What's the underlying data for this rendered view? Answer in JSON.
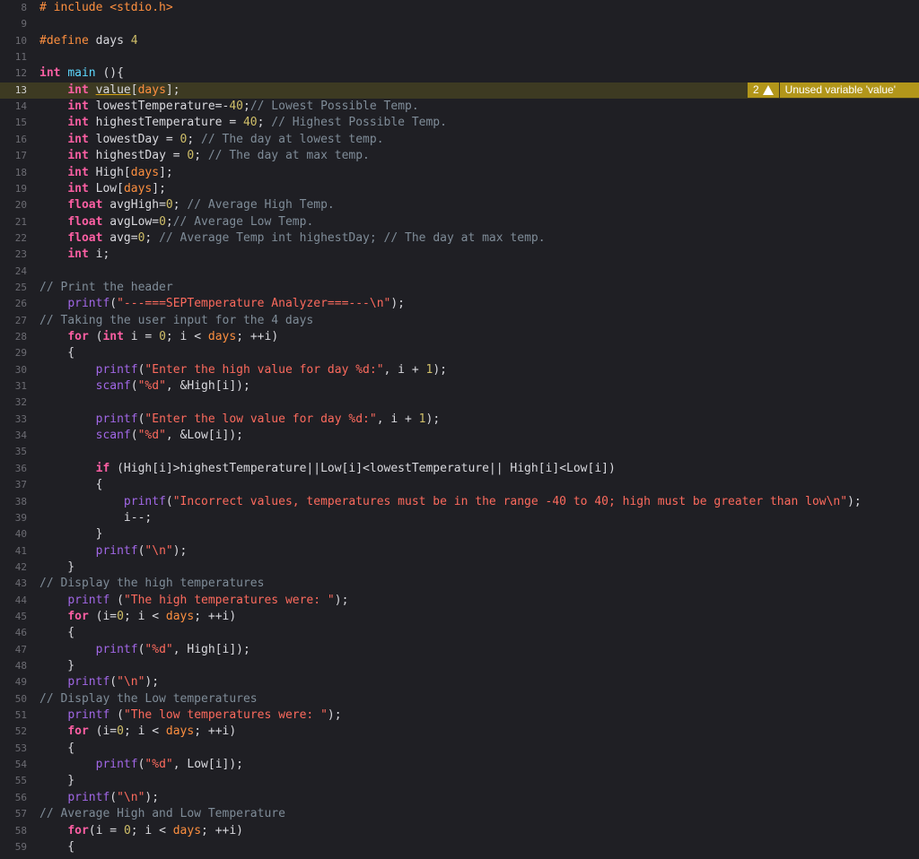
{
  "editor": {
    "lines": [
      {
        "n": "8",
        "code": "# include <stdio.h>"
      },
      {
        "n": "9",
        "code": ""
      },
      {
        "n": "10",
        "code": "#define days 4"
      },
      {
        "n": "11",
        "code": ""
      },
      {
        "n": "12",
        "code": "int main (){"
      },
      {
        "n": "13",
        "code": "    int value[days];"
      },
      {
        "n": "14",
        "code": "    int lowestTemperature=-40;// Lowest Possible Temp."
      },
      {
        "n": "15",
        "code": "    int highestTemperature = 40; // Highest Possible Temp."
      },
      {
        "n": "16",
        "code": "    int lowestDay = 0; // The day at lowest temp."
      },
      {
        "n": "17",
        "code": "    int highestDay = 0; // The day at max temp."
      },
      {
        "n": "18",
        "code": "    int High[days];"
      },
      {
        "n": "19",
        "code": "    int Low[days];"
      },
      {
        "n": "20",
        "code": "    float avgHigh=0; // Average High Temp."
      },
      {
        "n": "21",
        "code": "    float avgLow=0;// Average Low Temp."
      },
      {
        "n": "22",
        "code": "    float avg=0; // Average Temp int highestDay; // The day at max temp."
      },
      {
        "n": "23",
        "code": "    int i;"
      },
      {
        "n": "24",
        "code": ""
      },
      {
        "n": "25",
        "code": "// Print the header"
      },
      {
        "n": "26",
        "code": "    printf(\"---===SEPTemperature Analyzer===---\\n\");"
      },
      {
        "n": "27",
        "code": "// Taking the user input for the 4 days"
      },
      {
        "n": "28",
        "code": "    for (int i = 0; i < days; ++i)"
      },
      {
        "n": "29",
        "code": "    {"
      },
      {
        "n": "30",
        "code": "        printf(\"Enter the high value for day %d:\", i + 1);"
      },
      {
        "n": "31",
        "code": "        scanf(\"%d\", &High[i]);"
      },
      {
        "n": "32",
        "code": ""
      },
      {
        "n": "33",
        "code": "        printf(\"Enter the low value for day %d:\", i + 1);"
      },
      {
        "n": "34",
        "code": "        scanf(\"%d\", &Low[i]);"
      },
      {
        "n": "35",
        "code": ""
      },
      {
        "n": "36",
        "code": "        if (High[i]>highestTemperature||Low[i]<lowestTemperature|| High[i]<Low[i])"
      },
      {
        "n": "37",
        "code": "        {"
      },
      {
        "n": "38",
        "code": "            printf(\"Incorrect values, temperatures must be in the range -40 to 40; high must be greater than low\\n\");"
      },
      {
        "n": "39",
        "code": "            i--;"
      },
      {
        "n": "40",
        "code": "        }"
      },
      {
        "n": "41",
        "code": "        printf(\"\\n\");"
      },
      {
        "n": "42",
        "code": "    }"
      },
      {
        "n": "43",
        "code": "// Display the high temperatures"
      },
      {
        "n": "44",
        "code": "    printf (\"The high temperatures were: \");"
      },
      {
        "n": "45",
        "code": "    for (i=0; i < days; ++i)"
      },
      {
        "n": "46",
        "code": "    {"
      },
      {
        "n": "47",
        "code": "        printf(\"%d\", High[i]);"
      },
      {
        "n": "48",
        "code": "    }"
      },
      {
        "n": "49",
        "code": "    printf(\"\\n\");"
      },
      {
        "n": "50",
        "code": "// Display the Low temperatures"
      },
      {
        "n": "51",
        "code": "    printf (\"The low temperatures were: \");"
      },
      {
        "n": "52",
        "code": "    for (i=0; i < days; ++i)"
      },
      {
        "n": "53",
        "code": "    {"
      },
      {
        "n": "54",
        "code": "        printf(\"%d\", Low[i]);"
      },
      {
        "n": "55",
        "code": "    }"
      },
      {
        "n": "56",
        "code": "    printf(\"\\n\");"
      },
      {
        "n": "57",
        "code": "// Average High and Low Temperature"
      },
      {
        "n": "58",
        "code": "    for(i = 0; i < days; ++i)"
      },
      {
        "n": "59",
        "code": "    {"
      }
    ],
    "highlighted_line": "13",
    "warning": {
      "count": "2",
      "icon": "warning-triangle-icon",
      "message": "Unused variable 'value'"
    },
    "colors": {
      "background": "#1f1f24",
      "keyword": "#fc5fa3",
      "string": "#fc6a5d",
      "number": "#d0bf69",
      "comment": "#7f8c98",
      "warning_banner": "#b2961a",
      "highlight_line": "#3d3a22"
    }
  }
}
